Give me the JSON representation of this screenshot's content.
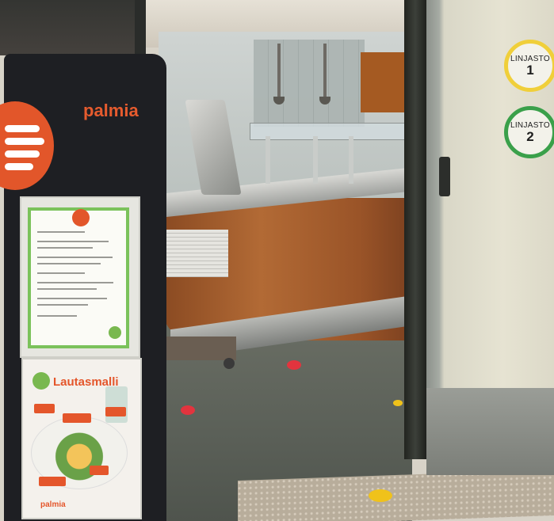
{
  "brand": {
    "name": "palmia",
    "color": "#e65b2e",
    "logo_color": "#e2562a"
  },
  "door_signs": [
    {
      "label": "LINJASTO",
      "number": "1",
      "ring_color": "#f0cf3a"
    },
    {
      "label": "LINJASTO",
      "number": "2",
      "ring_color": "#3aa04a"
    }
  ],
  "poster_bottom": {
    "title": "Lautasmalli",
    "brand": "palmia"
  },
  "floor_dots": [
    "#e2343e",
    "#f0c21a"
  ]
}
